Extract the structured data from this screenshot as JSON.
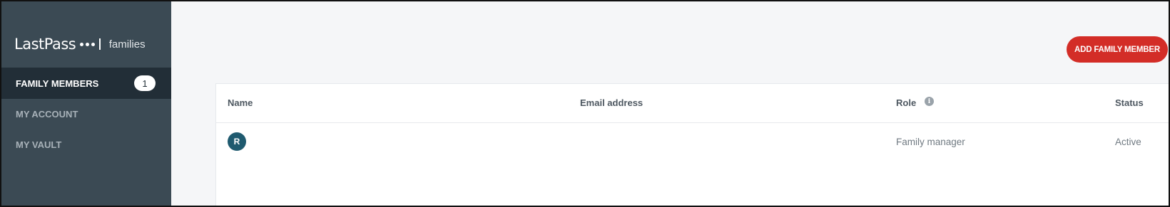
{
  "sidebar": {
    "logo_main": "LastPass",
    "logo_sub": "families",
    "items": [
      {
        "label": "FAMILY MEMBERS",
        "badge": "1",
        "active": true
      },
      {
        "label": "MY ACCOUNT"
      },
      {
        "label": "MY VAULT"
      }
    ]
  },
  "main": {
    "add_button_label": "ADD FAMILY MEMBER",
    "table": {
      "headers": {
        "name": "Name",
        "email": "Email address",
        "role": "Role",
        "status": "Status"
      },
      "rows": [
        {
          "avatar_initial": "R",
          "name": "",
          "email": "",
          "role": "Family manager",
          "status": "Active"
        }
      ]
    }
  },
  "colors": {
    "sidebar_bg": "#3b4a54",
    "sidebar_active_bg": "#222e37",
    "accent": "#d32d27",
    "avatar_bg": "#1f5a6f"
  },
  "icons": {
    "role_info": "info-icon"
  }
}
